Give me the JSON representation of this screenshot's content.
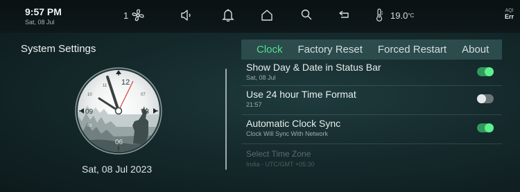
{
  "status_bar": {
    "time": "9:57 PM",
    "date": "Sat, 08 Jul",
    "fan_speed": "1",
    "temperature": "19.0",
    "temperature_unit": "°C",
    "aqi_label": "AQI",
    "aqi_value": "Err",
    "icons": [
      "fan-icon",
      "speaker-icon",
      "bell-icon",
      "home-icon",
      "search-icon",
      "return-icon",
      "thermometer-icon"
    ]
  },
  "page": {
    "title": "System Settings",
    "date_display": "Sat, 08 Jul 2023"
  },
  "clock": {
    "numbers": [
      "12",
      "09",
      "03",
      "06"
    ],
    "small_numbers": [
      "11",
      "10",
      "07",
      "08"
    ],
    "time_shown": "21:57"
  },
  "tabs": [
    {
      "label": "Clock",
      "active": true
    },
    {
      "label": "Factory Reset",
      "active": false
    },
    {
      "label": "Forced Restart",
      "active": false
    },
    {
      "label": "About",
      "active": false
    }
  ],
  "settings": [
    {
      "title": "Show Day & Date in Status Bar",
      "subtitle": "Sat, 08 Jul",
      "toggle": "on"
    },
    {
      "title": "Use 24 hour Time Format",
      "subtitle": "21:57",
      "toggle": "off"
    },
    {
      "title": "Automatic Clock Sync",
      "subtitle": "Clock Will Sync With Network",
      "toggle": "on"
    },
    {
      "title": "Select Time Zone",
      "subtitle": "India - UTC/GMT +05:30",
      "disabled": true
    }
  ],
  "colors": {
    "accent": "#4fe28a",
    "tab_bar": "#2c4b4c",
    "background": "#152a2c"
  }
}
